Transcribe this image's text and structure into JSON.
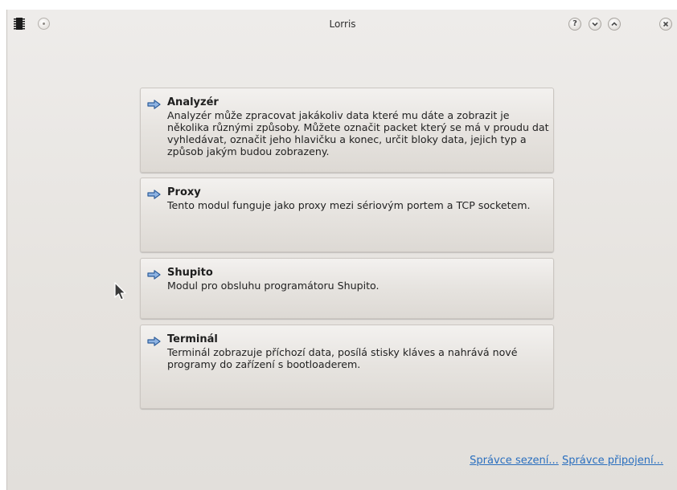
{
  "window": {
    "title": "Lorris",
    "help_button": "?"
  },
  "modules": [
    {
      "title": "Analyzér",
      "description": "Analyzér může zpracovat jakákoliv data které mu dáte a zobrazit je několika různými způsoby. Můžete označit packet který se má v proudu dat vyhledávat, označit jeho hlavičku a konec, určit bloky data, jejich typ a způsob jakým budou zobrazeny."
    },
    {
      "title": "Proxy",
      "description": "Tento modul funguje jako proxy mezi sériovým portem a TCP socketem."
    },
    {
      "title": "Shupito",
      "description": "Modul pro obsluhu programátoru Shupito."
    },
    {
      "title": "Terminál",
      "description": "Terminál zobrazuje příchozí data, posílá stisky kláves a nahrává nové programy do zařízení s bootloaderem."
    }
  ],
  "footer": {
    "session_manager": "Správce sezení...",
    "connection_manager": "Správce připojení..."
  },
  "colors": {
    "link": "#2a6fbf",
    "arrow_fill": "#8fb4e3",
    "arrow_stroke": "#2d5d9a"
  }
}
